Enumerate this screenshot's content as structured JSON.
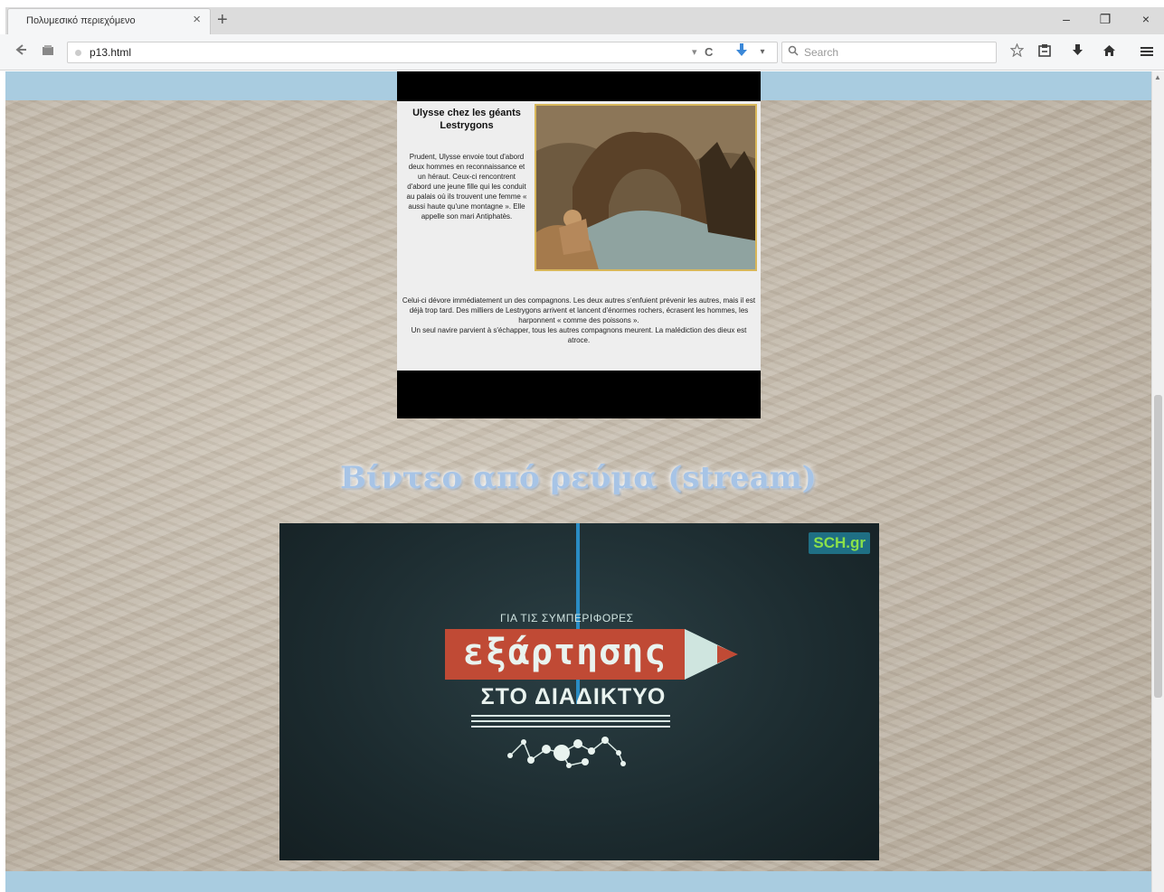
{
  "browser": {
    "tab_title": "Πολυμεσικό περιεχόμενο",
    "tab_close": "×",
    "new_tab": "+",
    "window_minimize": "–",
    "window_maximize": "❐",
    "window_close": "×",
    "url": "p13.html",
    "url_dropdown": "▾",
    "reload": "C",
    "search_placeholder": "Search",
    "icons": [
      "back-icon",
      "page-icon",
      "reload-icon",
      "pocket-icon",
      "search-icon",
      "bookmark-star-icon",
      "library-icon",
      "download-icon",
      "home-icon",
      "menu-icon"
    ]
  },
  "article": {
    "title": "Ulysse chez les géants Lestrygons",
    "intro": "Prudent, Ulysse envoie tout d'abord deux hommes en reconnaissance et un héraut. Ceux-ci rencontrent d'abord une jeune fille qui les conduit au palais où ils trouvent une femme « aussi haute qu'une montagne ». Elle appelle son mari Antiphatès.",
    "body_1": "Celui-ci dévore immédiatement un des compagnons. Les deux autres s'enfuient prévenir les autres, mais il est déjà trop tard. Des milliers de Lestrygons arrivent et lancent d'énormes rochers, écrasent les hommes, les harponnent « comme des poissons ».",
    "body_2": "Un seul navire parvient à s'échapper, tous les autres compagnons meurent. La malédiction des dieux est atroce."
  },
  "section_title": "Βίντεο από ρεύμα (stream)",
  "video": {
    "logo": "SCH.gr",
    "kicker": "ΓΙΑ ΤΙΣ ΣΥΜΠΕΡΙΦΟΡΕΣ",
    "headline": "εξάρτησης",
    "subline": "ΣΤΟ ΔΙΑΔΙΚΤΥΟ"
  },
  "colors": {
    "page_band": "#a9cce0",
    "video_bg": "#1e2f33",
    "pencil_red": "#c04a35",
    "logo_green": "#8ae04a"
  }
}
